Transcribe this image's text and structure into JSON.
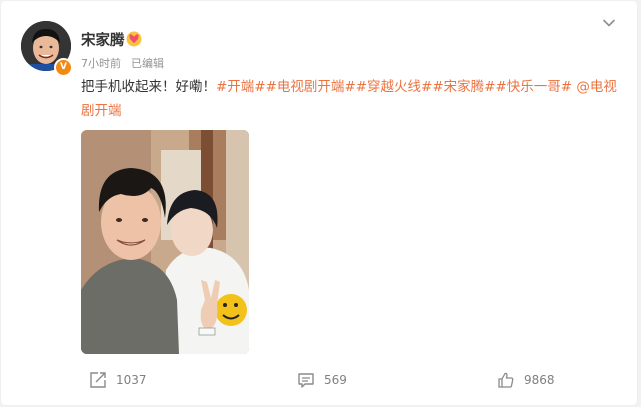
{
  "post": {
    "username": "宋家腾",
    "time": "7小时前",
    "edited": "已编辑",
    "text_plain": "把手机收起来！好嘞！",
    "hashtags": [
      "#开端#",
      "#电视剧开端#",
      "#穿越火线#",
      "#宋家腾#",
      "#快乐一哥#"
    ],
    "mention": "@电视剧开端"
  },
  "icons": {
    "menu": "chevron-down-icon",
    "verified": "verified-v-icon",
    "member": "member-heart-icon",
    "repost": "repost-icon",
    "comment": "comment-icon",
    "like": "thumbs-up-icon"
  },
  "actions": {
    "repost_count": "1037",
    "comment_count": "569",
    "like_count": "9868"
  },
  "colors": {
    "link": "#eb7340",
    "verified": "#f28a11",
    "text": "#333333",
    "meta": "#939393"
  }
}
